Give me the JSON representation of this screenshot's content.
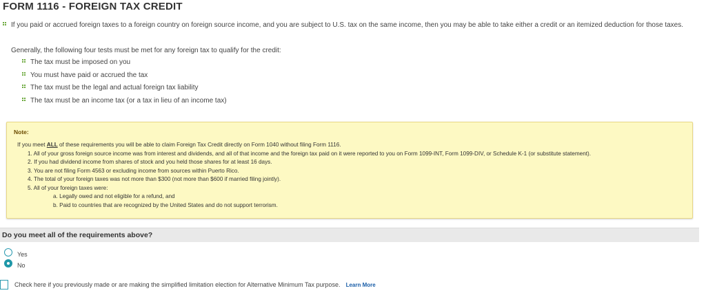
{
  "page": {
    "title": "FORM 1116 - FOREIGN TAX CREDIT"
  },
  "intro": "If you paid or accrued foreign taxes to a foreign country on foreign source income, and you are subject to U.S. tax on the same income, then you may be able to take either a credit or an itemized deduction for those taxes.",
  "tests": {
    "intro": "Generally, the following four tests must be met for any foreign tax to qualify for the credit:",
    "items": [
      "The tax must be imposed on you",
      "You must have paid or accrued the tax",
      "The tax must be the legal and actual foreign tax liability",
      "The tax must be an income tax (or a tax in lieu of an income tax)"
    ]
  },
  "note": {
    "title": "Note:",
    "lead_before": "If you meet ",
    "lead_emphasis": "ALL",
    "lead_after": " of these requirements you will be able to claim Foreign Tax Credit directly on Form 1040 without filing Form 1116.",
    "items": [
      "1. All of your gross foreign source income was from interest and dividends, and all of that income and the foreign tax paid on it were reported to you on Form 1099-INT, Form 1099-DIV, or Schedule K-1 (or substitute statement).",
      "2. If you had dividend income from shares of stock and you held those shares for at least 16 days.",
      "3. You are not filing Form 4563 or excluding income from sources within Puerto Rico.",
      "4. The total of your foreign taxes was not more than $300 (not more than $600 if married filing jointly).",
      "5. All of your foreign taxes were:"
    ],
    "subitems": [
      "a. Legally owed and not eligible for a refund, and",
      "b. Paid to countries that are recognized by the United States and do not support terrorism."
    ]
  },
  "question": {
    "text": "Do you meet all of the requirements above?",
    "options": [
      "Yes",
      "No"
    ],
    "selected": "No"
  },
  "amt": {
    "label": "Check here if you previously made or are making the simplified limitation election for Alternative Minimum Tax purpose.",
    "learn_more": "Learn More",
    "checked": false
  },
  "colors": {
    "accent": "#1f97a8",
    "bullet": "#6aa83b",
    "note_bg": "#fdf9c3",
    "note_border": "#e8d784",
    "link": "#1a5ea8"
  },
  "icons": {
    "bullet": "green-dot-bullet-icon"
  }
}
